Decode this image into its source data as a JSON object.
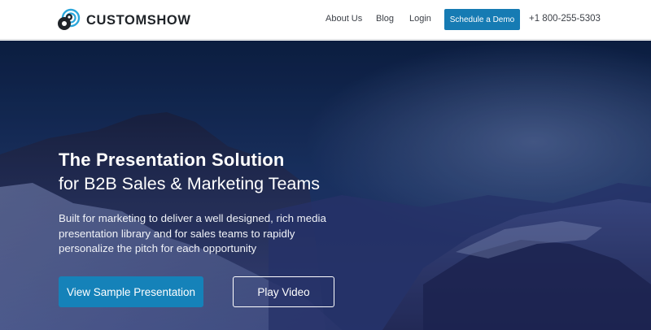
{
  "brand": {
    "name": "CUSTOMSHOW",
    "logo_icon": "customshow-logo-icon",
    "accent_color": "#167bb3"
  },
  "nav": {
    "about": "About Us",
    "blog": "Blog",
    "login": "Login",
    "demo_button": "Schedule a Demo",
    "phone": "+1 800-255-5303"
  },
  "hero": {
    "headline": "The Presentation Solution",
    "subheadline": "for B2B Sales & Marketing Teams",
    "description": "Built for marketing to deliver a well designed, rich media presentation library and for sales teams to rapidly personalize the pitch for each opportunity",
    "primary_button": "View Sample Presentation",
    "secondary_button": "Play Video",
    "background": "snowy-mountains-at-dusk"
  }
}
